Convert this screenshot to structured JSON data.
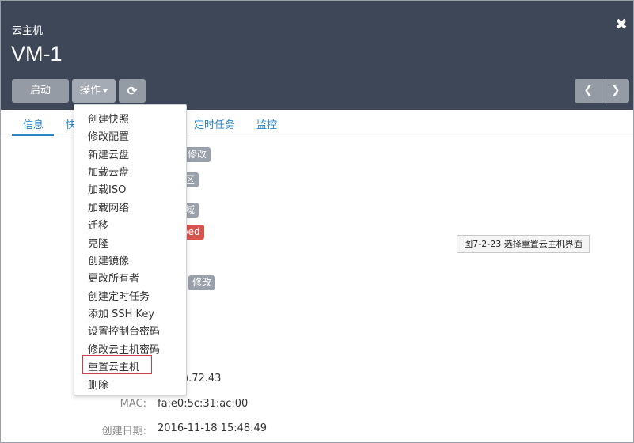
{
  "header": {
    "subtitle": "云主机",
    "title": "VM-1",
    "close_icon": "✖",
    "buttons": {
      "start": "启动",
      "operations": "操作",
      "refresh_icon": "⟳",
      "prev_icon": "❮",
      "next_icon": "❯"
    }
  },
  "tabs": [
    {
      "label": "信息"
    },
    {
      "label": "快"
    },
    {
      "label": "定时任务"
    },
    {
      "label": "监控"
    }
  ],
  "badges": [
    "修改",
    "区",
    "域",
    "ped",
    "修改"
  ],
  "menu": [
    "创建快照",
    "修改配置",
    "新建云盘",
    "加载云盘",
    "加载ISO",
    "加载网络",
    "迁移",
    "克隆",
    "创建镜像",
    "更改所有者",
    "创建定时任务",
    "添加 SSH Key",
    "设置控制台密码",
    "修改云主机密码",
    "重置云主机",
    "删除"
  ],
  "tooltip": "图7-2-23 选择重置云主机界面",
  "details": {
    "ip_value": ").72.43",
    "mac_label": "MAC:",
    "mac_value": "fa:e0:5c:31:ac:00",
    "created_label": "创建日期:",
    "created_value": "2016-11-18 15:48:49"
  },
  "colors": {
    "header_bg": "#3d4757",
    "accent": "#2a84c6",
    "button_bg": "#959ba5",
    "danger": "#d9534f",
    "highlight_border": "#c9434f"
  }
}
